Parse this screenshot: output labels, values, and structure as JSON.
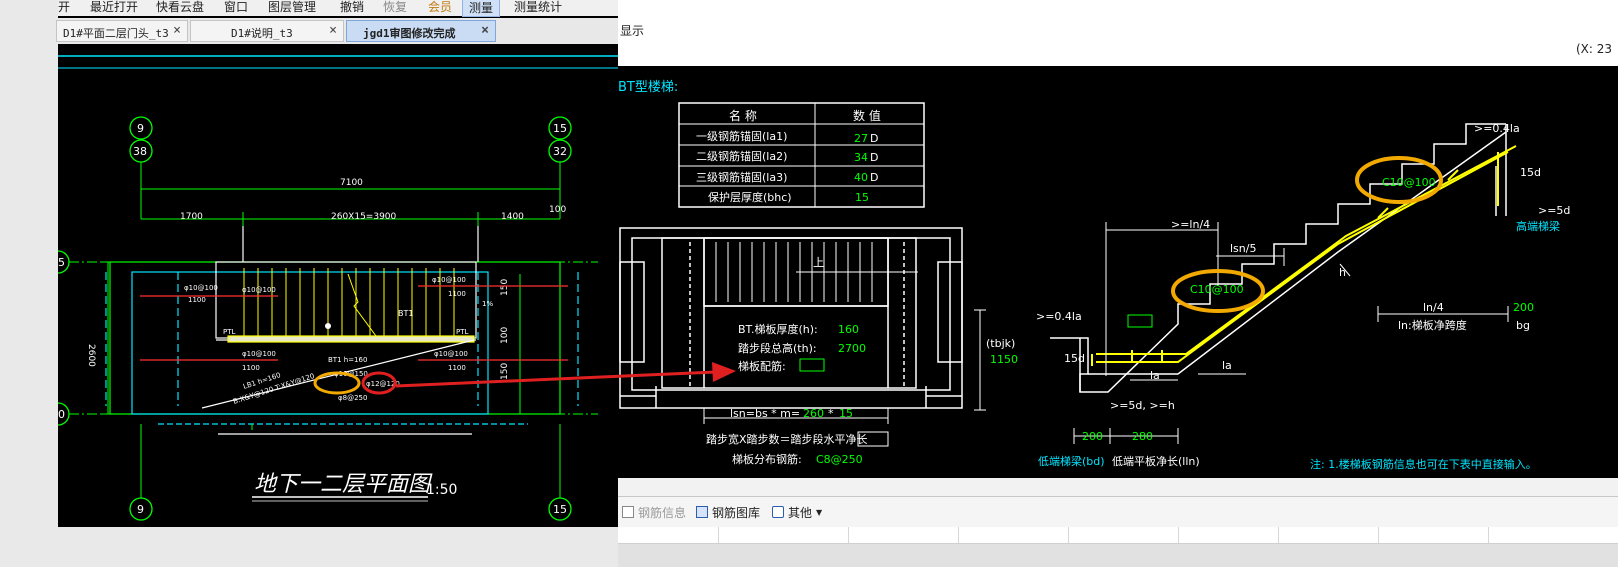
{
  "menu": {
    "items": [
      "开",
      "最近打开",
      "快看云盘",
      "窗口",
      "图层管理",
      "撤销",
      "恢复",
      "会员",
      "测量",
      "测量统计"
    ]
  },
  "tabs": [
    {
      "label": "D1#平面二层门头_t3",
      "active": false
    },
    {
      "label": "D1#说明_t3",
      "active": false
    },
    {
      "label": "jgd1审图修改完成",
      "active": true
    }
  ],
  "plan": {
    "title": "地下一二层平面图",
    "scale": "1:50",
    "axis_top": [
      "9",
      "38",
      "15",
      "32"
    ],
    "axis_left": [
      "5",
      "0"
    ],
    "axis_bottom": [
      "9",
      "15"
    ],
    "dims": [
      "7100",
      "1700",
      "260X15=3900",
      "1400",
      "100",
      "2600",
      "150",
      "100",
      "150"
    ],
    "bar_labels": [
      "φ10@100",
      "φ10@100",
      "1100",
      "φ10@100",
      "1100",
      "φ10@100",
      "1100",
      "φ10@100",
      "1100",
      "BT1",
      "BT1 h=160",
      "LB1 h=160",
      "B:X&Y@120 T:X&Y@120",
      "φ10@150",
      "φ12@120",
      "φ8@250",
      "PTL",
      "PTL",
      "1%"
    ]
  },
  "right_window": {
    "hint": "显示",
    "coord": "(X: 23",
    "heading": "BT型楼梯:",
    "table": {
      "headers": [
        "名 称",
        "数 值"
      ],
      "rows": [
        {
          "name": "一级钢筋锚固(la1)",
          "value": "27",
          "unit": "D"
        },
        {
          "name": "二级钢筋锚固(la2)",
          "value": "34",
          "unit": "D"
        },
        {
          "name": "三级钢筋锚固(la3)",
          "value": "40",
          "unit": "D"
        },
        {
          "name": "保护层厚度(bhc)",
          "value": "15",
          "unit": ""
        }
      ]
    },
    "plan_view": {
      "up": "上",
      "thick_label": "BT.梯板厚度(h):",
      "thick_value": "160",
      "height_label": "踏步段总高(th):",
      "height_value": "2700",
      "rebar_label": "梯板配筋:",
      "tbjk": "(tbjk)",
      "tbjk_value": "1150",
      "lsn_label": "lsn=bs * m=",
      "lsn_bs": "260",
      "lsn_m": "15",
      "formula": "踏步宽X踏步数＝踏步段水平净长",
      "dist_label": "梯板分布钢筋:",
      "dist_value": "C8@250"
    },
    "section": {
      "rebar_top": "C10@100",
      "rebar_mid": "C10@100",
      "ln4_left": ">=ln/4",
      "lsn5": "lsn/5",
      "h": "h",
      "ge04la_top": ">=0.4la",
      "ge04la_left": ">=0.4la",
      "d15_right": "15d",
      "d5_right": ">=5d",
      "high_beam": "高端梯梁",
      "ln4_right": "ln/4",
      "bg_value": "200",
      "ln_label": "ln:梯板净跨度",
      "bg": "bg",
      "d15_left": "15d",
      "la1": "la",
      "la2": "la",
      "d5h": ">=5d, >=h",
      "bd_value": "200",
      "lln_value": "280",
      "low_beam": "低端梯梁(bd)",
      "low_plate": "低端平板净长(lln)",
      "note": "注: 1.楼梯板钢筋信息也可在下表中直接输入。"
    },
    "toolbar": [
      "钢筋信息",
      "钢筋图库",
      "其他"
    ]
  },
  "colors": {
    "highlight_ring": "#f2a900",
    "red_ring": "#e02020",
    "arrow": "#e02020",
    "cad_cyan": "#00e5ff",
    "cad_green": "#00ff00",
    "cad_yellow": "#ffff00",
    "cad_white": "#ffffff"
  }
}
